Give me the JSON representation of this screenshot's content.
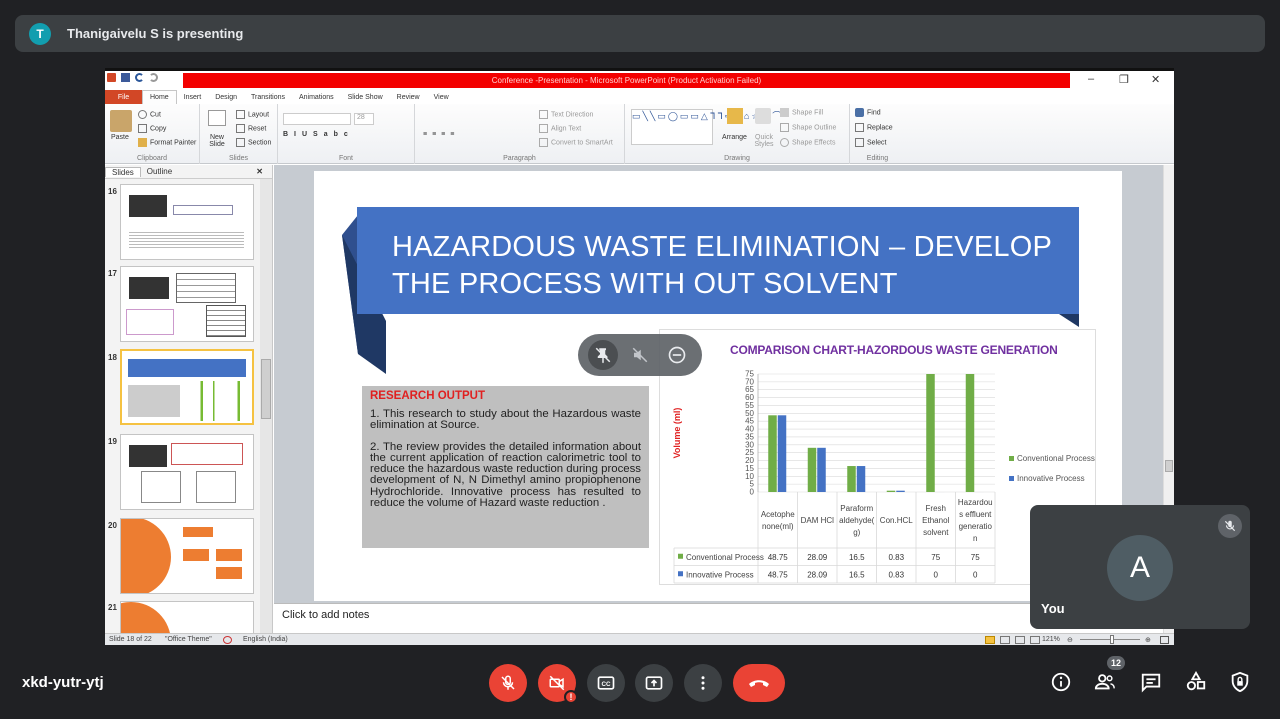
{
  "meet": {
    "presenter_initial": "T",
    "presenting_text": "Thanigaivelu S is presenting",
    "meeting_code": "xkd-yutr-ytj",
    "participants_count": "12",
    "you_label": "You",
    "you_initial": "A"
  },
  "ppt": {
    "window_title": "Conference -Presentation - Microsoft PowerPoint (Product Activation Failed)",
    "tabs": [
      "File",
      "Home",
      "Insert",
      "Design",
      "Transitions",
      "Animations",
      "Slide Show",
      "Review",
      "View"
    ],
    "active_tab": "Home",
    "ribbon": {
      "paste": "Paste",
      "cut": "Cut",
      "copy": "Copy",
      "format_painter": "Format Painter",
      "clipboard": "Clipboard",
      "new_slide": "New Slide",
      "layout": "Layout",
      "reset": "Reset",
      "section": "Section",
      "slides": "Slides",
      "font_size": "28",
      "font": "Font",
      "text_direction": "Text Direction",
      "align_text": "Align Text",
      "convert_smartart": "Convert to SmartArt",
      "paragraph": "Paragraph",
      "arrange": "Arrange",
      "quick_styles": "Quick Styles",
      "shape_fill": "Shape Fill",
      "shape_outline": "Shape Outline",
      "shape_effects": "Shape Effects",
      "drawing": "Drawing",
      "find": "Find",
      "replace": "Replace",
      "select": "Select",
      "editing": "Editing"
    },
    "panel_tabs": [
      "Slides",
      "Outline"
    ],
    "slide_numbers": [
      "16",
      "17",
      "18",
      "19",
      "20",
      "21"
    ],
    "notes_placeholder": "Click to add notes",
    "status": {
      "slide_of": "Slide 18 of 22",
      "theme": "\"Office Theme\"",
      "language": "English (India)",
      "zoom": "121%"
    }
  },
  "slide": {
    "title_line1": "HAZARDOUS WASTE ELIMINATION – DEVELOP",
    "title_line2": "THE PROCESS WITH OUT SOLVENT",
    "research_title": "RESEARCH OUTPUT",
    "research_p1": "1. This research  to study about the Hazardous waste elimination at Source.",
    "research_p2": "2. The review provides the detailed information about the current application of reaction calorimetric tool to reduce the hazardous waste reduction during process development of N, N Dimethyl amino propiophenone Hydrochloride. Innovative process has resulted to reduce the volume of Hazard waste reduction ."
  },
  "chart_data": {
    "type": "bar",
    "title": "COMPARISON CHART-HAZORDOUS WASTE GENERATION",
    "ylabel": "Volume (ml)",
    "ylim": [
      0,
      75
    ],
    "yticks": [
      "75",
      "70",
      "65",
      "60",
      "55",
      "50",
      "45",
      "40",
      "35",
      "30",
      "25",
      "20",
      "15",
      "10",
      "5",
      "0"
    ],
    "categories": [
      [
        "Acetophe",
        "none(ml)"
      ],
      [
        "DAM HCl"
      ],
      [
        "Paraform",
        "aldehyde(",
        "g)"
      ],
      [
        "Con.HCL"
      ],
      [
        "Fresh",
        "Ethanol",
        "solvent"
      ],
      [
        "Hazardou",
        "s effluent",
        "generatio",
        "n"
      ]
    ],
    "series": [
      {
        "name": "Conventional Process",
        "color": "#70ad47",
        "values": [
          48.75,
          28.09,
          16.5,
          0.83,
          75,
          75
        ],
        "labels": [
          "48.75",
          "28.09",
          "16.5",
          "0.83",
          "75",
          "75"
        ]
      },
      {
        "name": "Innovative Process",
        "color": "#4472c4",
        "values": [
          48.75,
          28.09,
          16.5,
          0.83,
          0,
          0
        ],
        "labels": [
          "48.75",
          "28.09",
          "16.5",
          "0.83",
          "0",
          "0"
        ]
      }
    ],
    "legend": "right",
    "grid": true
  }
}
